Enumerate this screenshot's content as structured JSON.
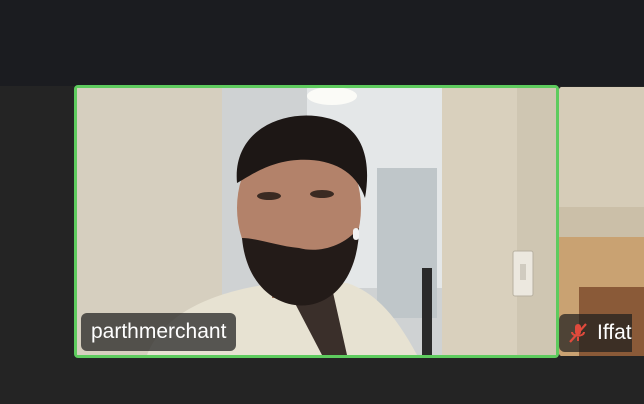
{
  "meeting": {
    "active_speaker": {
      "name": "parthmerchant"
    },
    "other_participant": {
      "name": "Iffat",
      "mic_status": "muted",
      "mic_icon": "mic-muted-icon",
      "mic_icon_color": "#e04a3c"
    },
    "active_speaker_border_color": "#5ecb5e"
  }
}
